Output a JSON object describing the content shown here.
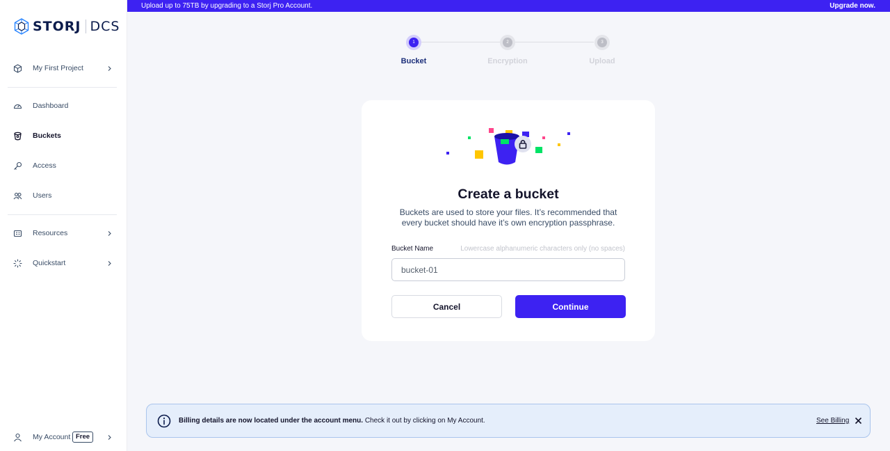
{
  "logo": {
    "brand": "STORJ",
    "product": "DCS"
  },
  "banner": {
    "text": "Upload up to 75TB by upgrading to a Storj Pro Account.",
    "link": "Upgrade now."
  },
  "sidebar": {
    "project": "My First Project",
    "items": [
      {
        "label": "Dashboard",
        "icon": "dashboard-icon"
      },
      {
        "label": "Buckets",
        "icon": "bucket-icon",
        "active": true
      },
      {
        "label": "Access",
        "icon": "key-icon"
      },
      {
        "label": "Users",
        "icon": "users-icon"
      }
    ],
    "resources": "Resources",
    "quickstart": "Quickstart",
    "account": "My Account",
    "account_badge": "Free"
  },
  "steps": [
    {
      "number": "1",
      "label": "Bucket",
      "state": "active"
    },
    {
      "number": "2",
      "label": "Encryption",
      "state": "inactive"
    },
    {
      "number": "3",
      "label": "Upload",
      "state": "inactive"
    }
  ],
  "card": {
    "title": "Create a bucket",
    "description": "Buckets are used to store your files. It’s recommended that every bucket should have it’s own encryption passphrase.",
    "field_label": "Bucket Name",
    "field_hint": "Lowercase alphanumeric characters only (no spaces)",
    "input_value": "bucket-01",
    "cancel": "Cancel",
    "continue": "Continue"
  },
  "notice": {
    "bold": "Billing details are now located under the account menu.",
    "text": " Check it out by clicking on My Account.",
    "link": "See Billing"
  },
  "colors": {
    "accent": "#3d22f2",
    "notice_bg": "#e5eefb"
  }
}
